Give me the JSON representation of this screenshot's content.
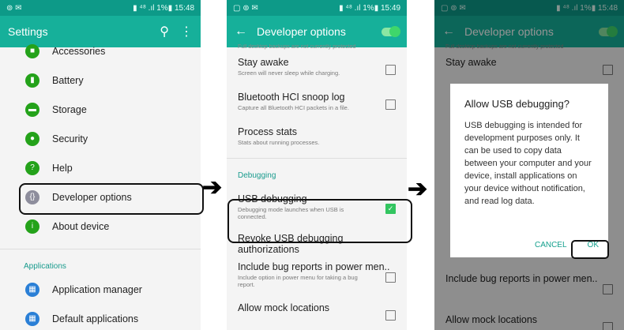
{
  "panel1": {
    "status": {
      "left": "⊚ ✉",
      "right": "▮ ⁴⁸ .ıl 1%▮ 15:48"
    },
    "title": "Settings",
    "items": [
      {
        "label": "Accessories",
        "icon": "accessories-icon"
      },
      {
        "label": "Battery",
        "icon": "battery-icon"
      },
      {
        "label": "Storage",
        "icon": "storage-icon"
      },
      {
        "label": "Security",
        "icon": "security-icon"
      },
      {
        "label": "Help",
        "icon": "help-icon"
      },
      {
        "label": "Developer options",
        "icon": "developer-options-icon"
      },
      {
        "label": "About device",
        "icon": "about-device-icon"
      }
    ],
    "section": "Applications",
    "apps": [
      {
        "label": "Application manager",
        "icon": "application-manager-icon"
      },
      {
        "label": "Default applications",
        "icon": "default-applications-icon"
      }
    ]
  },
  "panel2": {
    "status": {
      "left": "▢ ⊚ ✉",
      "right": "▮ ⁴⁸ .ıl 1%▮ 15:49"
    },
    "title": "Developer options",
    "top_note": "Full desktop backups are not currently protected",
    "rows": [
      {
        "title": "Stay awake",
        "sub": "Screen will never sleep while charging."
      },
      {
        "title": "Bluetooth HCI snoop log",
        "sub": "Capture all Bluetooth HCI packets in a file."
      },
      {
        "title": "Process stats",
        "sub": "Stats about running processes."
      }
    ],
    "section": "Debugging",
    "usb": {
      "title": "USB debugging",
      "sub": "Debugging mode launches when USB is connected."
    },
    "revoke": "Revoke USB debugging authorizations",
    "bugreports": {
      "title": "Include bug reports in power men..",
      "sub": "Include option in power menu for taking a bug report."
    },
    "mock": "Allow mock locations"
  },
  "panel3": {
    "status": {
      "left": "▢ ⊚ ✉",
      "right": "▮ ⁴⁸ .ıl 1%▮ 15:48"
    },
    "title": "Developer options",
    "top_note": "Full desktop backups are not currently protected",
    "stay_awake": "Stay awake",
    "bugreports": "Include bug reports in power men..",
    "mock": "Allow mock locations",
    "dialog": {
      "title": "Allow USB debugging?",
      "body": "USB debugging is intended for development purposes only. It can be used to copy data between your computer and your device, install applications on your device without notification, and read log data.",
      "cancel": "CANCEL",
      "ok": "OK"
    }
  },
  "colors": {
    "accent": "#16b09a",
    "statusbar": "#0d9a88",
    "icon_green": "#24a21a",
    "check_green": "#33c560"
  },
  "arrows": [
    "➔",
    "➔"
  ]
}
